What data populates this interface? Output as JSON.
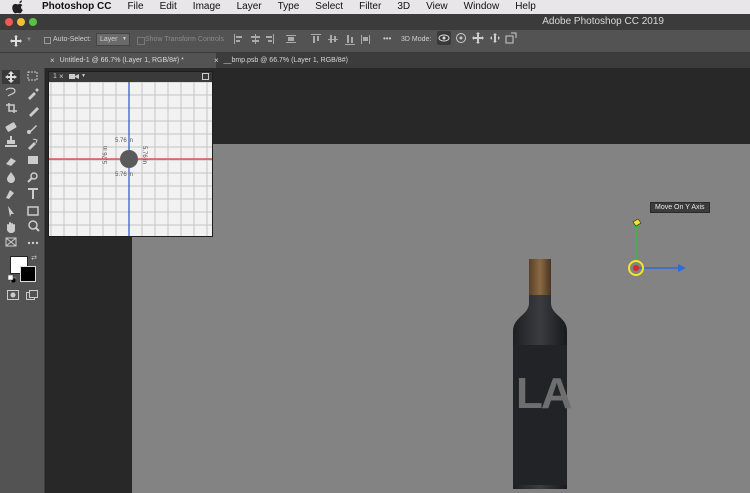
{
  "menubar": {
    "app_name": "Photoshop CC",
    "items": [
      "File",
      "Edit",
      "Image",
      "Layer",
      "Type",
      "Select",
      "Filter",
      "3D",
      "View",
      "Window",
      "Help"
    ]
  },
  "window": {
    "title": "Adobe Photoshop CC 2019"
  },
  "options": {
    "auto_select_label": "Auto-Select:",
    "auto_select_value": "Layer",
    "show_transform_label": "Show Transform Controls",
    "mode_label": "3D Mode:",
    "more_label": "•••"
  },
  "tabs": [
    {
      "label": "Untitled-1 @ 66.7% (Layer 1, RGB/8#) *",
      "active": true
    },
    {
      "label": "__bmp.psb @ 66.7% (Layer 1, RGB/8#)",
      "active": false
    }
  ],
  "view_panel": {
    "camera_label": "1",
    "measure_top": "5.76 in",
    "measure_bottom": "5.76 in",
    "measure_left": "5.76 in",
    "measure_right": "5.76 in"
  },
  "tooltip": {
    "text": "Move On Y Axis"
  },
  "bottle": {
    "label_text": "LA"
  },
  "colors": {
    "accent": "#2f6bd8",
    "ui_bg": "#535353",
    "canvas": "#838383"
  }
}
